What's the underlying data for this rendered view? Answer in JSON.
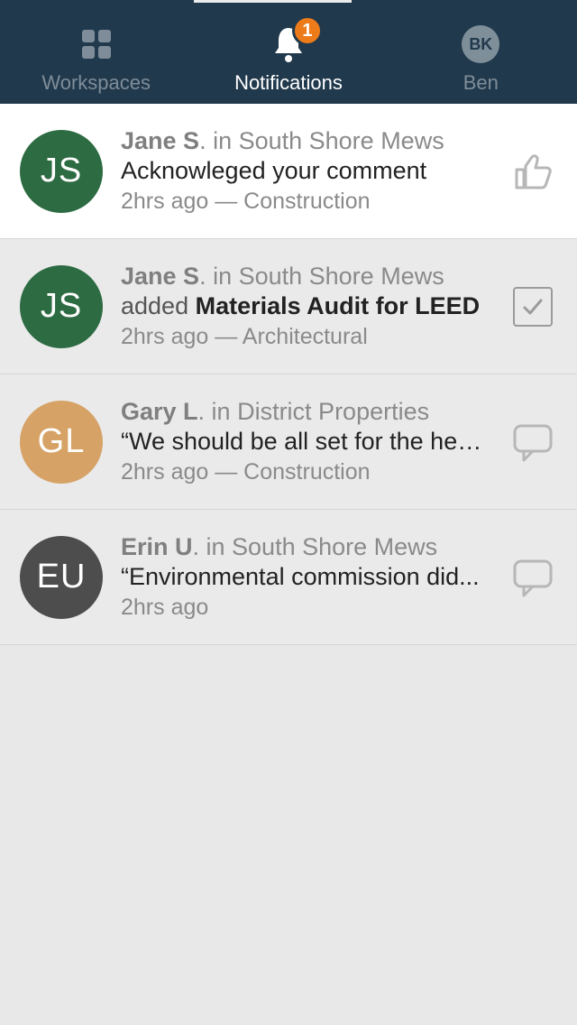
{
  "header": {
    "tabs": {
      "workspaces": "Workspaces",
      "notifications": "Notifications",
      "profile": "Ben"
    },
    "badge_count": "1",
    "profile_initials": "BK"
  },
  "colors": {
    "avatar_green": "#2d6b42",
    "avatar_tan": "#d6a266",
    "avatar_gray": "#4d4d4d"
  },
  "notifications": [
    {
      "initials": "JS",
      "avatar_color": "avatar_green",
      "actor": "Jane S",
      "location_prefix": ". in ",
      "location": "South Shore Mews",
      "body_plain": "Acknowleged your comment",
      "time": "2hrs ago",
      "category": "Construction",
      "icon": "thumb",
      "unread": true
    },
    {
      "initials": "JS",
      "avatar_color": "avatar_green",
      "actor": "Jane S",
      "location_prefix": ". in ",
      "location": "South Shore Mews",
      "body_prefix": "added ",
      "body_strong": "Materials Audit for LEED",
      "time": "2hrs ago",
      "category": "Architectural",
      "icon": "checkbox",
      "unread": false
    },
    {
      "initials": "GL",
      "avatar_color": "avatar_tan",
      "actor": "Gary L",
      "location_prefix": ". in ",
      "location": "District Properties",
      "body_plain": "“We should be all set for the hea...",
      "time": "2hrs ago",
      "category": "Construction",
      "icon": "comment",
      "unread": false
    },
    {
      "initials": "EU",
      "avatar_color": "avatar_gray",
      "actor": "Erin U",
      "location_prefix": ". in ",
      "location": "South Shore Mews",
      "body_plain": "“Environmental commission did...",
      "time": "2hrs ago",
      "category": "",
      "icon": "comment",
      "unread": false
    }
  ]
}
